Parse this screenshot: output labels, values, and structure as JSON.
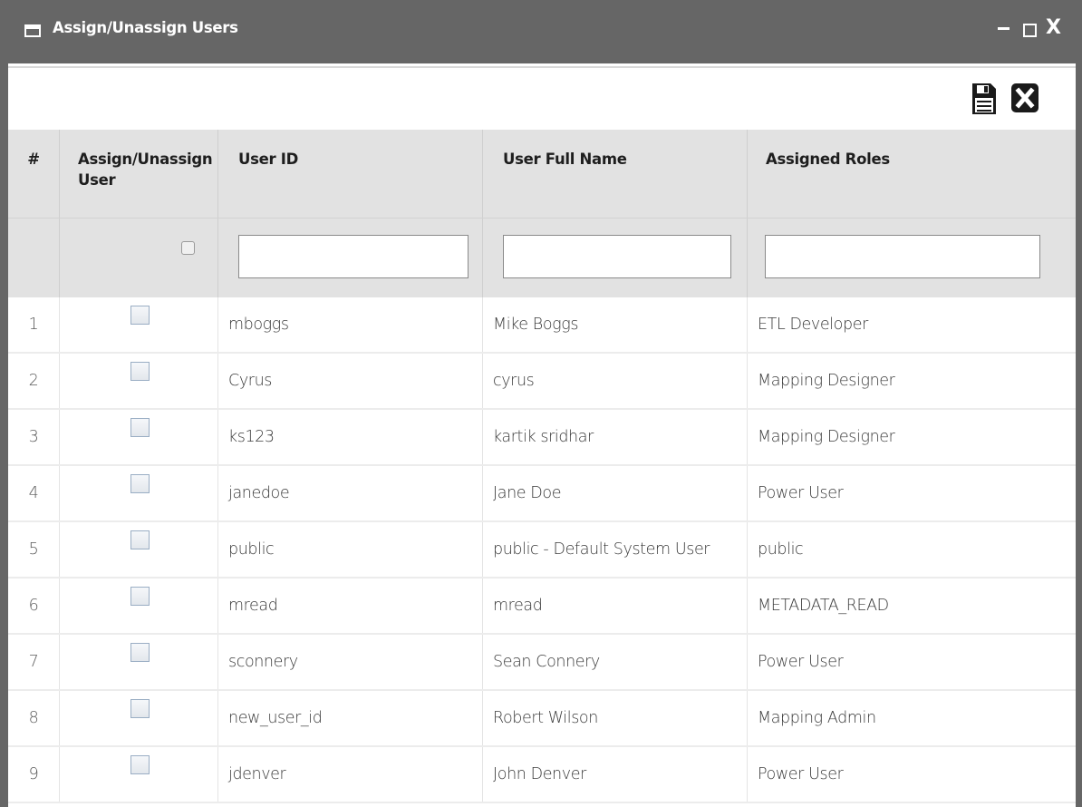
{
  "window": {
    "title": "Assign/Unassign Users",
    "controls": {
      "minimize": "_",
      "maximize": "□",
      "close": "X"
    }
  },
  "toolbar": {
    "save_icon": "save-icon",
    "close_icon": "close-icon"
  },
  "table": {
    "columns": {
      "number": "#",
      "assign_line1": "Assign/Unassign",
      "assign_line2": "User",
      "user_id": "User ID",
      "full_name": "User Full Name",
      "roles": "Assigned Roles"
    },
    "rows": [
      {
        "num": "1",
        "user_id": "mboggs",
        "full_name": "Mike Boggs",
        "roles": "ETL Developer"
      },
      {
        "num": "2",
        "user_id": "Cyrus",
        "full_name": "cyrus",
        "roles": "Mapping Designer"
      },
      {
        "num": "3",
        "user_id": "ks123",
        "full_name": "kartik sridhar",
        "roles": "Mapping Designer"
      },
      {
        "num": "4",
        "user_id": "janedoe",
        "full_name": "Jane Doe",
        "roles": "Power User"
      },
      {
        "num": "5",
        "user_id": "public",
        "full_name": "public - Default System User",
        "roles": "public"
      },
      {
        "num": "6",
        "user_id": "mread",
        "full_name": "mread",
        "roles": "METADATA_READ"
      },
      {
        "num": "7",
        "user_id": "sconnery",
        "full_name": "Sean Connery",
        "roles": "Power User"
      },
      {
        "num": "8",
        "user_id": "new_user_id",
        "full_name": "Robert Wilson",
        "roles": "Mapping Admin"
      },
      {
        "num": "9",
        "user_id": "jdenver",
        "full_name": "John Denver",
        "roles": "Power User"
      }
    ]
  },
  "colors": {
    "titlebar": "#666666",
    "header_bg": "#e2e2e2"
  }
}
